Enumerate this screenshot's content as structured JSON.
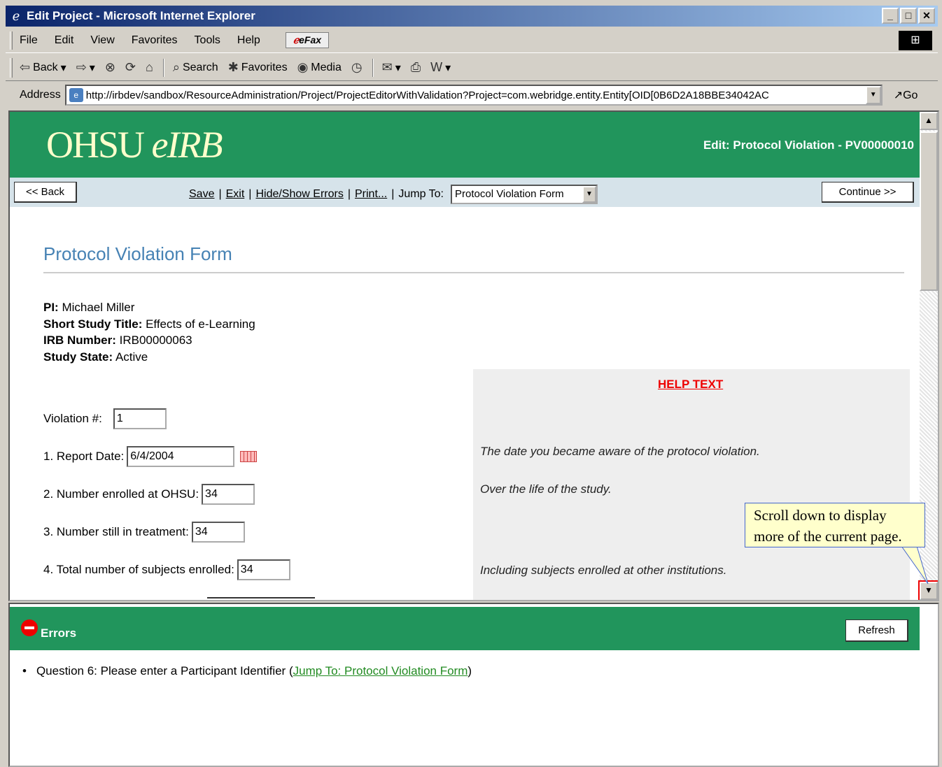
{
  "window": {
    "title": "Edit Project - Microsoft Internet Explorer",
    "min": "_",
    "max": "□",
    "close": "✕"
  },
  "menu": {
    "items": [
      "File",
      "Edit",
      "View",
      "Favorites",
      "Tools",
      "Help"
    ],
    "efax": "eFax"
  },
  "toolbar": {
    "back": "Back",
    "search": "Search",
    "favorites": "Favorites",
    "media": "Media"
  },
  "address": {
    "label": "Address",
    "url": "http://irbdev/sandbox/ResourceAdministration/Project/ProjectEditorWithValidation?Project=com.webridge.entity.Entity[OID[0B6D2A18BBE34042AC",
    "go": "Go"
  },
  "page": {
    "logo_main": "OHSU",
    "logo_sub": "eIRB",
    "edit_title": "Edit: Protocol Violation - PV00000010",
    "back_button": "<< Back",
    "continue_button": "Continue >>",
    "links": {
      "save": "Save",
      "exit": "Exit",
      "hide_show": "Hide/Show Errors",
      "print": "Print...",
      "jump_to": "Jump To:"
    },
    "jump_select_value": "Protocol Violation Form",
    "form_title": "Protocol Violation Form",
    "info": {
      "pi_label": "PI:",
      "pi_value": " Michael  Miller",
      "title_label": "Short Study Title:",
      "title_value": " Effects of e-Learning",
      "irb_label": "IRB Number:",
      "irb_value": " IRB00000063",
      "state_label": "Study State:",
      "state_value": " Active"
    },
    "questions": {
      "violation_label": "Violation #:",
      "violation_value": "1",
      "q1_label": "1. Report Date:",
      "q1_value": "6/4/2004",
      "q2_label": "2.  Number enrolled at OHSU:",
      "q2_value": "34",
      "q3_label": "3.  Number still in treatment:",
      "q3_value": "34",
      "q4_label": "4.  Total number of subjects enrolled:",
      "q4_value": "34"
    },
    "help": {
      "title": "HELP TEXT",
      "line1": "The date you became aware of the protocol violation.",
      "line2": "Over the life of the study.",
      "line3": "Including subjects enrolled at other institutions."
    },
    "tooltip": {
      "line1": "Scroll down to display",
      "line2": "more of the current page."
    }
  },
  "errors": {
    "title": "Errors",
    "refresh": "Refresh",
    "item_text": "Question 6: Please enter a Participant Identifier (",
    "item_link": "Jump To: Protocol Violation Form",
    "item_close": ")"
  }
}
